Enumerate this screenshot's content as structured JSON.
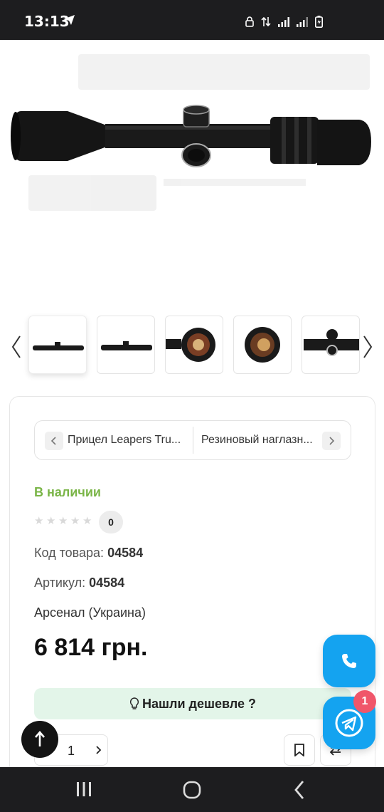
{
  "status_bar": {
    "time": "13:13",
    "icons": [
      "telegram-send-icon",
      "lock-icon",
      "data-arrows-icon",
      "signal-icon",
      "signal-icon",
      "battery-icon"
    ]
  },
  "product": {
    "images": [
      "scope-side-view",
      "scope-side-view-2",
      "scope-lens-front",
      "scope-lens-front-2",
      "scope-turret-closeup"
    ]
  },
  "related": {
    "prev_label": "Прицел Leapers Tru...",
    "next_label": "Резиновый наглазн..."
  },
  "details": {
    "stock_status": "В наличии",
    "rating_count": "0",
    "code_label": "Код товара:",
    "code_value": "04584",
    "sku_label": "Артикул:",
    "sku_value": "04584",
    "manufacturer": "Арсенал (Украина)",
    "price": "6 814 грн.",
    "cheaper_label": "Нашли дешевле ?",
    "quantity": "1"
  },
  "widgets": {
    "chat_badge": "1"
  },
  "colors": {
    "stock_green": "#7ab547",
    "fab_blue": "#14a3f0",
    "badge_red": "#f0566a",
    "cheaper_bg": "#e3f5e9"
  }
}
